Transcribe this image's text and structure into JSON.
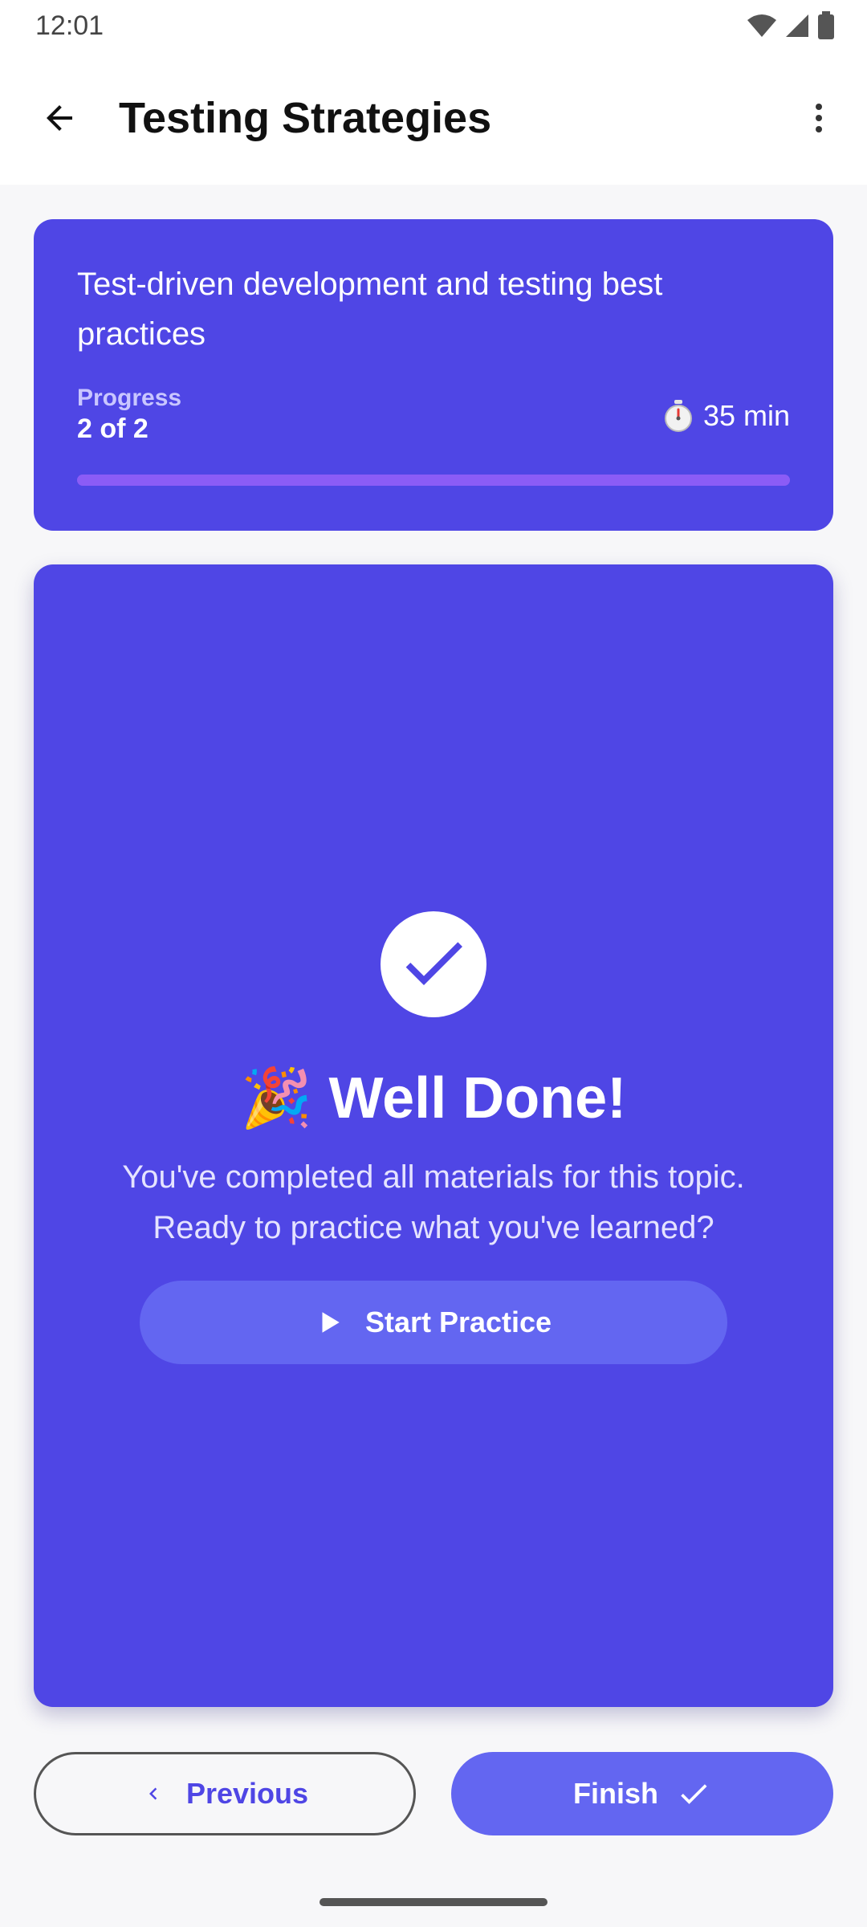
{
  "status_bar": {
    "time": "12:01",
    "icons": [
      "wifi-icon",
      "signal-icon",
      "battery-icon"
    ]
  },
  "app_bar": {
    "title": "Testing Strategies",
    "back_icon": "arrow-back-icon",
    "menu_icon": "more-vert-icon"
  },
  "topic_card": {
    "description": "Test-driven development and testing best practices",
    "progress_label": "Progress",
    "progress_value": "2 of 2",
    "progress_fraction": 1.0,
    "duration_icon": "stopwatch-icon",
    "duration": "35 min"
  },
  "completion": {
    "icon": "check-circle-icon",
    "emoji": "🎉",
    "title": "Well Done!",
    "line1": "You've completed all materials for this topic.",
    "line2": "Ready to practice what you've learned?",
    "practice_button": "Start Practice"
  },
  "navigation": {
    "previous_label": "Previous",
    "finish_label": "Finish"
  },
  "colors": {
    "primary": "#4f46e5",
    "button": "#6366f1",
    "progress": "#8b5cf6"
  }
}
